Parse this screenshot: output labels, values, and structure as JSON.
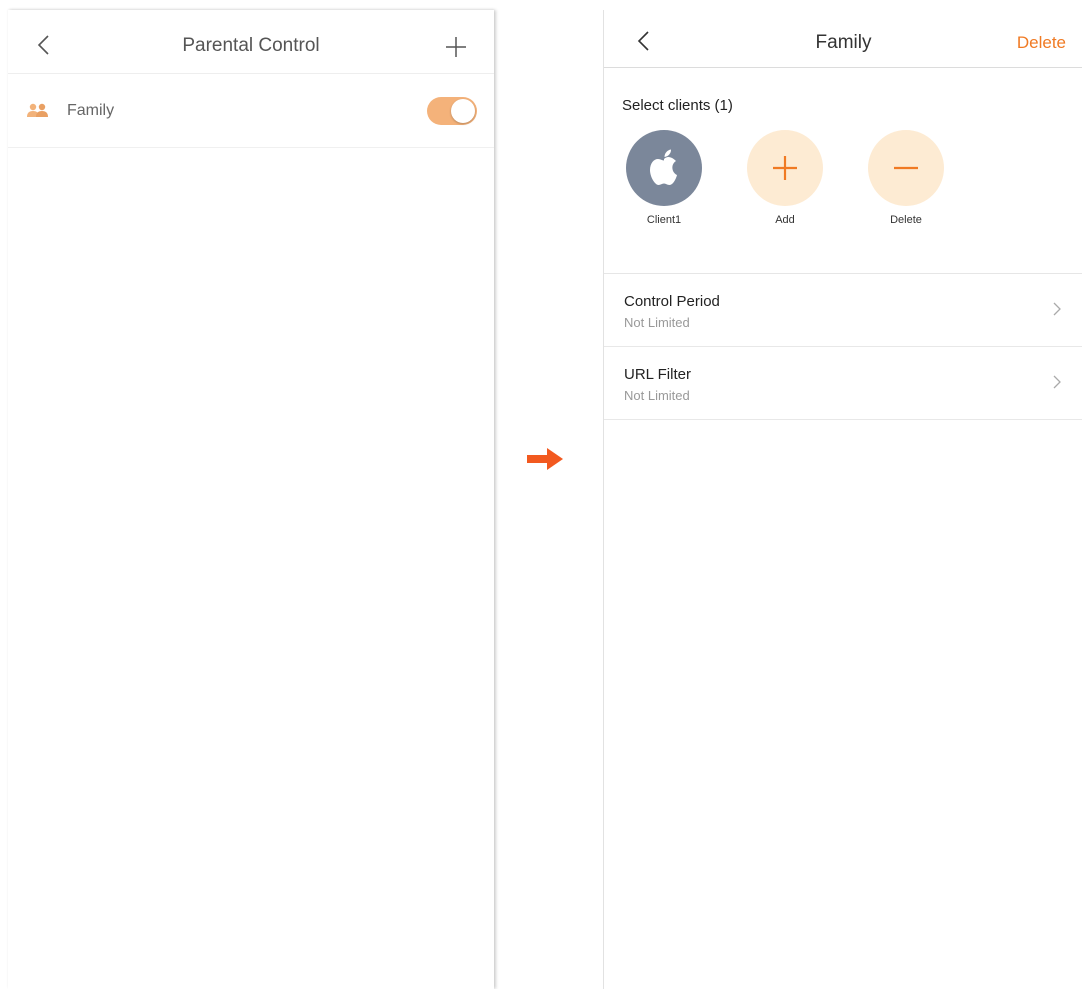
{
  "left_screen": {
    "title": "Parental Control",
    "back_icon": "chevron-left-icon",
    "add_icon": "plus-icon",
    "rows": [
      {
        "label": "Family",
        "icon": "group-users-icon",
        "toggle_on": true
      }
    ]
  },
  "arrow_icon": "arrow-right-icon",
  "right_screen": {
    "title": "Family",
    "back_icon": "chevron-left-icon",
    "delete_label": "Delete",
    "clients": {
      "heading": "Select clients (1)",
      "items": [
        {
          "label": "Client1",
          "icon": "apple-logo-icon"
        },
        {
          "label": "Add",
          "icon": "plus-icon"
        },
        {
          "label": "Delete",
          "icon": "minus-icon"
        }
      ]
    },
    "menu": [
      {
        "title": "Control Period",
        "subtitle": "Not Limited"
      },
      {
        "title": "URL Filter",
        "subtitle": "Not Limited"
      }
    ]
  },
  "colors": {
    "accent": "#f07a23",
    "toggle_on": "#f4b27a",
    "client_circle": "#7b879a",
    "action_circle": "#fdebd3",
    "arrow": "#f2591f"
  }
}
